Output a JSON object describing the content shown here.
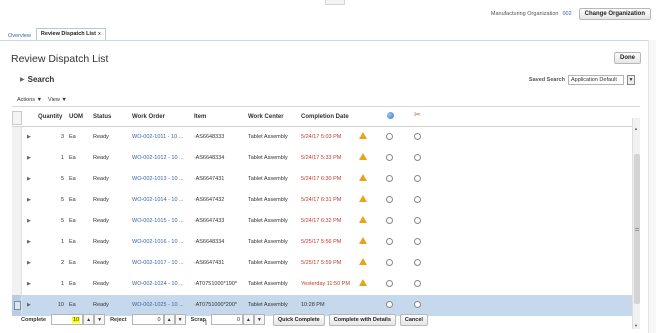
{
  "header": {
    "org_label": "Manufacturing Organization",
    "org_value": "002",
    "change_org_label": "Change Organization"
  },
  "tabs": [
    {
      "label": "Overview"
    },
    {
      "label": "Review Dispatch List",
      "close": "x"
    }
  ],
  "page": {
    "title": "Review Dispatch List",
    "done_label": "Done",
    "search_label": "Search",
    "search_toggle": "▶",
    "saved_search_label": "Saved Search",
    "saved_search_value": "Application Default",
    "dropdown_icon": "▼"
  },
  "toolbar": {
    "actions_label": "Actions ▼",
    "view_label": "View ▼"
  },
  "table": {
    "columns": {
      "quantity": "Quantity",
      "uom": "UOM",
      "status": "Status",
      "work_order": "Work Order",
      "item": "Item",
      "work_center": "Work Center",
      "completion_date": "Completion Date",
      "globe_icon": "globe-icon",
      "tools_icon": "tools-icon"
    },
    "expand_glyph": "▶",
    "rows": [
      {
        "quantity": "3",
        "uom": "Ea",
        "status": "Ready",
        "work_order": "WO-002-1011 - 10 ...",
        "item_mark": "*",
        "item": "AS6648333",
        "work_center": "Tablet Assembly",
        "completion_date": "5/24/17 5:03 PM",
        "date_color": "red",
        "warning": true
      },
      {
        "quantity": "1",
        "uom": "Ea",
        "status": "Ready",
        "work_order": "WO-002-1012 - 10 ...",
        "item_mark": "*",
        "item": "AS6648334",
        "work_center": "Tablet Assembly",
        "completion_date": "5/24/17 5:33 PM",
        "date_color": "red",
        "warning": true
      },
      {
        "quantity": "5",
        "uom": "Ea",
        "status": "Ready",
        "work_order": "WO-002-1013 - 10 ...",
        "item_mark": "*",
        "item": "AS6647431",
        "work_center": "Tablet Assembly",
        "completion_date": "5/24/17 6:30 PM",
        "date_color": "red",
        "warning": true
      },
      {
        "quantity": "5",
        "uom": "Ea",
        "status": "Ready",
        "work_order": "WO-002-1014 - 10 ...",
        "item_mark": "*",
        "item": "AS6647432",
        "work_center": "Tablet Assembly",
        "completion_date": "5/24/17 6:31 PM",
        "date_color": "red",
        "warning": true
      },
      {
        "quantity": "5",
        "uom": "Ea",
        "status": "Ready",
        "work_order": "WO-002-1015 - 10 ...",
        "item_mark": "*",
        "item": "AS6647433",
        "work_center": "Tablet Assembly",
        "completion_date": "5/24/17 6:32 PM",
        "date_color": "red",
        "warning": true
      },
      {
        "quantity": "1",
        "uom": "Ea",
        "status": "Ready",
        "work_order": "WO-002-1016 - 10 ...",
        "item_mark": "*",
        "item": "AS6648334",
        "work_center": "Tablet Assembly",
        "completion_date": "5/25/17 5:56 PM",
        "date_color": "red",
        "warning": true
      },
      {
        "quantity": "2",
        "uom": "Ea",
        "status": "Ready",
        "work_order": "WO-002-1017 - 10 ...",
        "item_mark": "*",
        "item": "AS6647431",
        "work_center": "Tablet Assembly",
        "completion_date": "5/25/17 5:59 PM",
        "date_color": "red",
        "warning": true
      },
      {
        "quantity": "1",
        "uom": "Ea",
        "status": "Ready",
        "work_order": "WO-002-1024 - 10 ...",
        "item_mark": "*",
        "item": "AT0751000*190*",
        "work_center": "Tablet Assembly",
        "completion_date": "Yesterday 11:50 PM",
        "date_color": "red",
        "warning": true
      },
      {
        "quantity": "10",
        "uom": "Ea",
        "status": "Ready",
        "work_order": "WO-002-1025 - 10 ...",
        "item_mark": "*",
        "item": "AT0751000*200*",
        "work_center": "Tablet Assembly",
        "completion_date": "10:28 PM",
        "date_color": "normal",
        "warning": false,
        "selected": true
      }
    ]
  },
  "footer": {
    "complete_label": "Complete",
    "complete_value": "10",
    "reject_label": "Reject",
    "reject_value": "0",
    "scrap_label": "Scrap",
    "scrap_value": "0",
    "up_glyph": "▲",
    "down_glyph": "▼",
    "quick_complete_label": "Quick Complete",
    "complete_with_details_label": "Complete with Details",
    "cancel_label": "Cancel"
  },
  "colors": {
    "link": "#3565a8",
    "late_date": "#c0392b",
    "selected_row": "#c6d9ec",
    "warning": "#e8a317",
    "highlight": "#ffff00"
  }
}
